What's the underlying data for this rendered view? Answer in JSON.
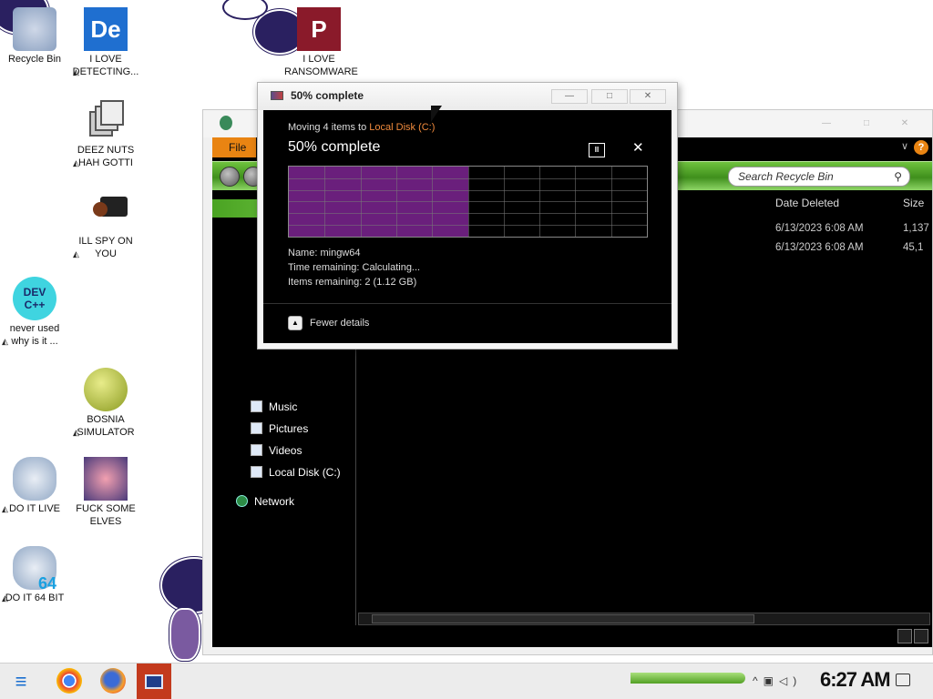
{
  "desktop": {
    "icons": [
      {
        "label": "Recycle Bin"
      },
      {
        "label": "I LOVE DETECTING..."
      },
      {
        "label": "I LOVE RANSOMWARE"
      },
      {
        "label": "DEEZ NUTS HAH GOTTI"
      },
      {
        "label": "ILL SPY ON YOU"
      },
      {
        "label": "never used why is it ..."
      },
      {
        "label": "BOSNIA SIMULATOR"
      },
      {
        "label": "DO IT LIVE"
      },
      {
        "label": "FUCK SOME ELVES"
      },
      {
        "label": "DO IT 64 BIT"
      }
    ],
    "dev_icon_text": "DEV C++",
    "de_icon_text": "De",
    "p_icon_text": "P",
    "badge_64": "64"
  },
  "explorer": {
    "menu": {
      "file_label": "File",
      "help_label": "?"
    },
    "search": {
      "placeholder": "Search Recycle Bin"
    },
    "nav_items": [
      {
        "label": "Music"
      },
      {
        "label": "Pictures"
      },
      {
        "label": "Videos"
      },
      {
        "label": "Local Disk (C:)"
      },
      {
        "label": "Network"
      }
    ],
    "columns": {
      "date_deleted": "Date Deleted",
      "size": "Size"
    },
    "rows": [
      {
        "date_deleted": "6/13/2023 6:08 AM",
        "size": "1,137"
      },
      {
        "date_deleted": "6/13/2023 6:08 AM",
        "size": "45,1"
      }
    ]
  },
  "dialog": {
    "title": "50% complete",
    "moving_prefix": "Moving 4 items to ",
    "destination": "Local Disk (C:)",
    "headline": "50% complete",
    "progress_fraction": 0.5,
    "name_label": "Name: ",
    "name_value": "mingw64",
    "time_label": "Time remaining: ",
    "time_value": "Calculating...",
    "items_label": "Items remaining: ",
    "items_value": "2 (1.12 GB)",
    "fewer_details": "Fewer details",
    "colors": {
      "fill": "#6a1f7c",
      "destination": "#f08a3c"
    }
  },
  "taskbar": {
    "clock": "6:27 AM"
  }
}
